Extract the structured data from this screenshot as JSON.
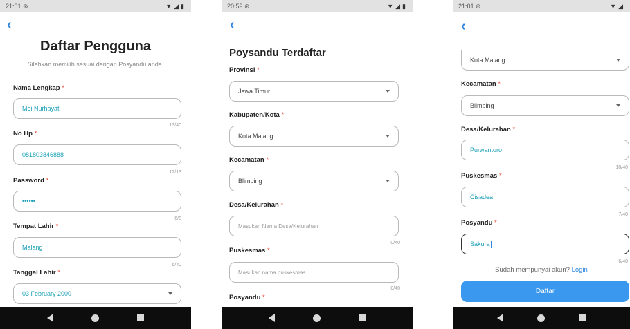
{
  "phones": [
    {
      "status_time": "21:01",
      "title": "Daftar Pengguna",
      "subtitle": "Silahkan memilih sesuai dengan Posyandu anda.",
      "fields": [
        {
          "label": "Nama Lengkap",
          "value": "Mei Nurhayati",
          "counter": "13/40"
        },
        {
          "label": "No Hp",
          "value": "081803846888",
          "counter": "12/13"
        },
        {
          "label": "Password",
          "value": "••••••",
          "counter": "6/8"
        },
        {
          "label": "Tempat Lahir",
          "value": "Malang",
          "counter": "6/40"
        },
        {
          "label": "Tanggal Lahir",
          "value": "03 February 2000"
        }
      ]
    },
    {
      "status_time": "20:59",
      "title": "Poysandu Terdaftar",
      "fields": [
        {
          "label": "Provinsi",
          "value": "Jawa Timur"
        },
        {
          "label": "Kabupaten/Kota",
          "value": "Kota Malang"
        },
        {
          "label": "Kecamatan",
          "value": "Blimbing"
        },
        {
          "label": "Desa/Kelurahan",
          "placeholder": "Masukan Nama Desa/Kelurahan",
          "counter": "0/40"
        },
        {
          "label": "Puskesmas",
          "placeholder": "Masukan nama puskesmas",
          "counter": "0/40"
        },
        {
          "label": "Posyandu"
        }
      ]
    },
    {
      "status_time": "21:01",
      "fields": [
        {
          "value": "Kota Malang"
        },
        {
          "label": "Kecamatan",
          "value": "Blimbing"
        },
        {
          "label": "Desa/Kelurahan",
          "value": "Purwantoro",
          "counter": "10/40"
        },
        {
          "label": "Puskesmas",
          "value": "Cisadea",
          "counter": "7/40"
        },
        {
          "label": "Posyandu",
          "value": "Sakura",
          "counter": "6/40"
        }
      ],
      "login_prompt": "Sudah mempunyai akun?",
      "login_link": "Login",
      "submit_label": "Daftar"
    }
  ],
  "required_mark": "*",
  "icons": {
    "back": "chevron-left-icon",
    "dropdown": "caret-down-icon",
    "nav": [
      "nav-back-icon",
      "nav-home-icon",
      "nav-recents-icon"
    ]
  },
  "colors": {
    "accent": "#2e86de",
    "button": "#3a98ee",
    "required": "#e74c3c",
    "input_text": "#1ba1b5",
    "status_bar": "#e2e2e2",
    "nav_bar": "#0d0d0d"
  }
}
